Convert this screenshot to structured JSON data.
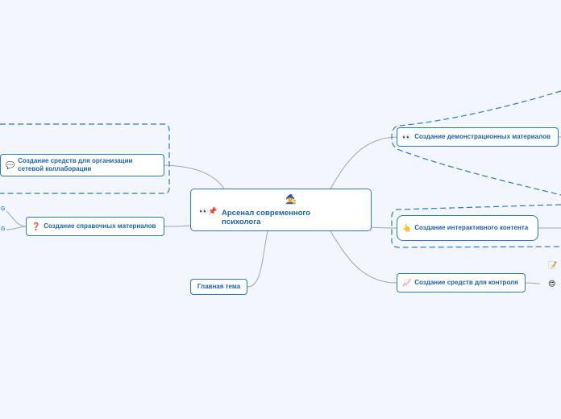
{
  "root": {
    "title": "Арсенал современного психолога",
    "icons": [
      "mage-icon",
      "eyes-icon",
      "pushpin-icon"
    ]
  },
  "nodes": {
    "demo": {
      "label": "Создание демонстрационных материалов",
      "icon": "eyes-icon"
    },
    "interactive": {
      "label": "Создание интерактивного контента",
      "icon": "pointing-hand-icon"
    },
    "control": {
      "label": "Создание средств для контроля",
      "icon": "chart-icon"
    },
    "collab": {
      "label": "Создание средств для организации сетевой коллаборации",
      "icon": "speech-bubble-icon"
    },
    "reference": {
      "label": "Создание справочных материалов",
      "icon": "question-mark-icon"
    },
    "main_topic": {
      "label": "Главная тема"
    }
  },
  "colors": {
    "accent": "#2a7ac0",
    "text": "#1e62a8",
    "connector": "#9aa7b5",
    "background": "#f3f7fd"
  }
}
